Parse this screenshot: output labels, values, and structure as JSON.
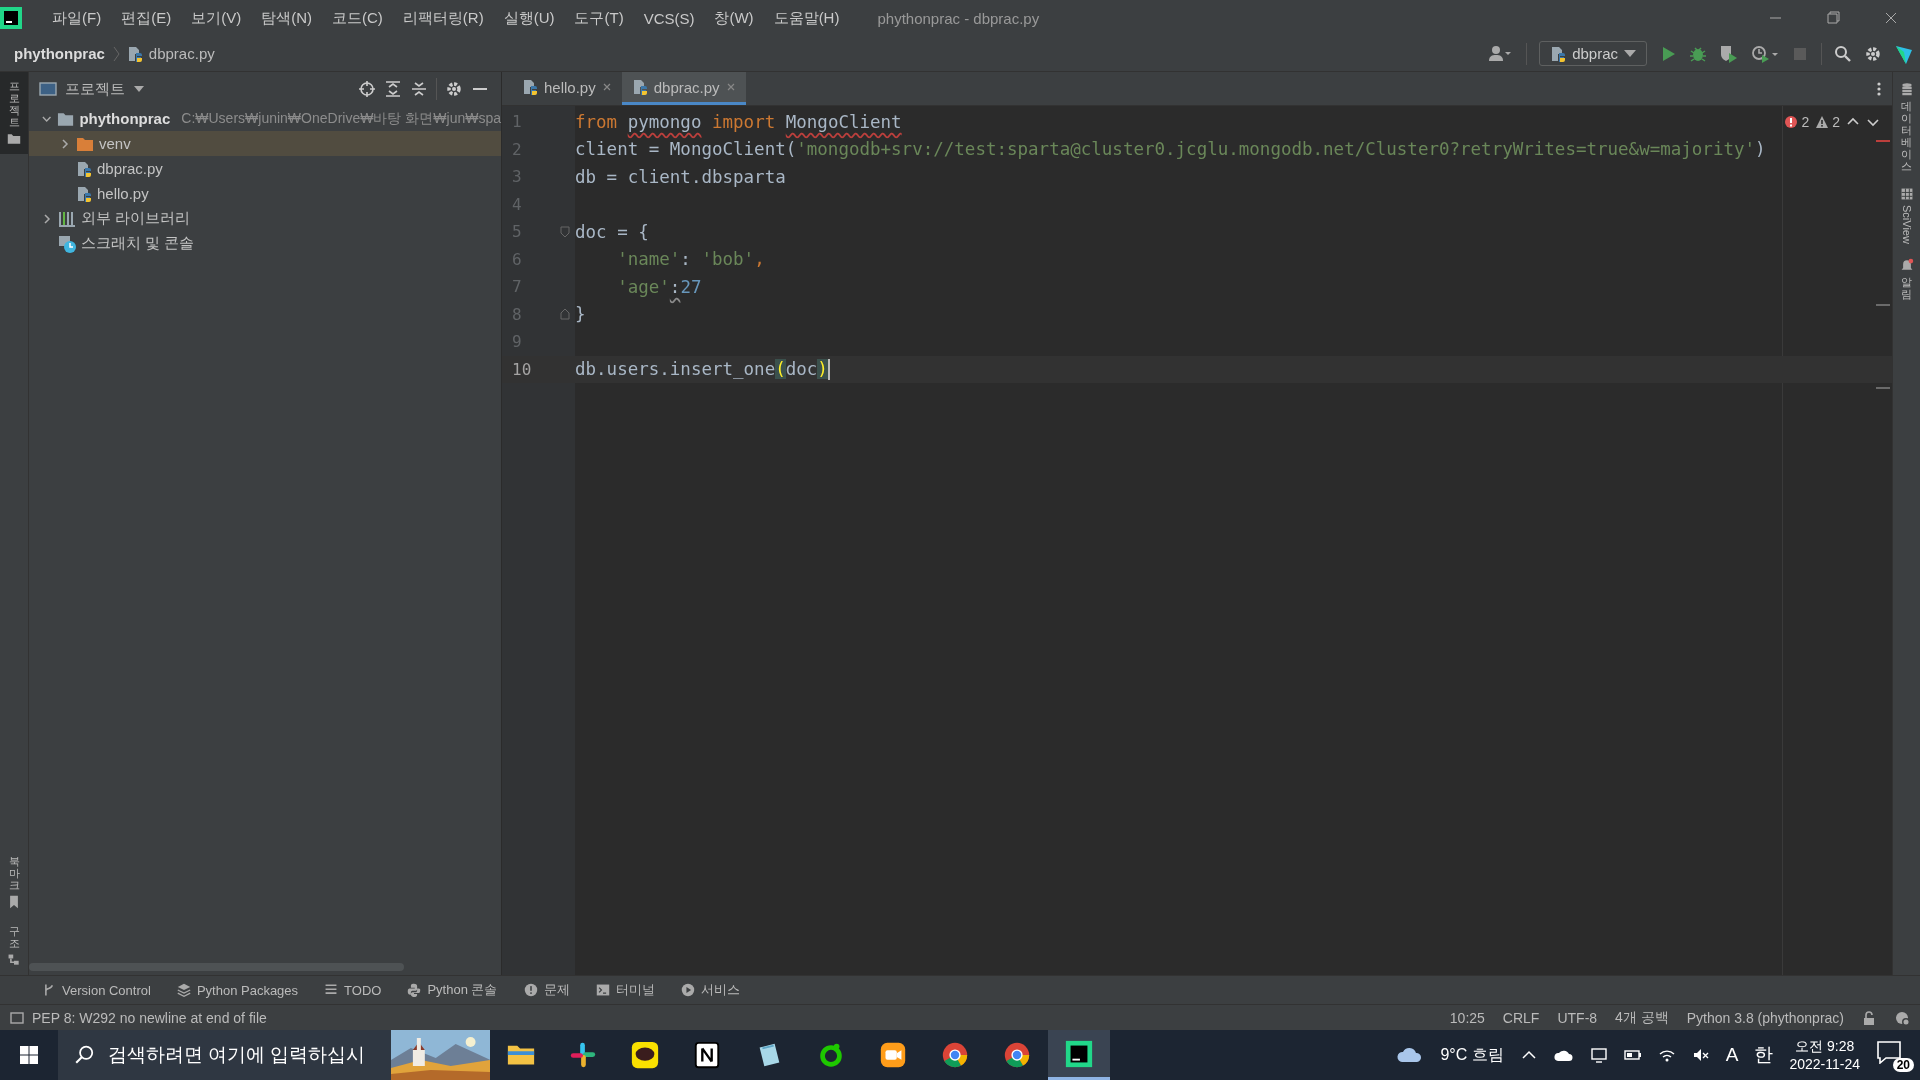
{
  "window": {
    "title": "phythonprac - dbprac.py"
  },
  "menu": [
    "파일(F)",
    "편집(E)",
    "보기(V)",
    "탐색(N)",
    "코드(C)",
    "리팩터링(R)",
    "실행(U)",
    "도구(T)",
    "VCS(S)",
    "창(W)",
    "도움말(H)"
  ],
  "breadcrumbs": [
    "phythonprac",
    "dbprac.py"
  ],
  "run_config": {
    "label": "dbprac"
  },
  "left_strip": [
    {
      "label": "프로젝트",
      "kind": "project",
      "selected": true
    },
    {
      "label": "북마크",
      "kind": "bookmarks",
      "selected": false
    },
    {
      "label": "구조",
      "kind": "structure",
      "selected": false
    }
  ],
  "right_strip": [
    {
      "label": "데이터베이스",
      "kind": "database"
    },
    {
      "label": "SciView",
      "kind": "sciview"
    },
    {
      "label": "알림",
      "kind": "notifications"
    }
  ],
  "project_panel": {
    "title": "프로젝트",
    "tree": [
      {
        "label": "phythonprac",
        "path": "C:₩Users₩junin₩OneDrive₩바탕 화면₩jun₩spa",
        "kind": "folder",
        "expanded": true,
        "selected": false,
        "children": [
          {
            "label": "venv",
            "kind": "venv",
            "expanded": false,
            "selected": true
          },
          {
            "label": "dbprac.py",
            "kind": "python",
            "selected": false
          },
          {
            "label": "hello.py",
            "kind": "python",
            "selected": false
          }
        ]
      },
      {
        "label": "외부 라이브러리",
        "kind": "library",
        "expanded": false,
        "selected": false
      },
      {
        "label": "스크래치 및 콘솔",
        "kind": "scratch",
        "selected": false
      }
    ]
  },
  "tabs": [
    {
      "label": "hello.py",
      "selected": false
    },
    {
      "label": "dbprac.py",
      "selected": true
    }
  ],
  "inspections": {
    "errors": "2",
    "warnings": "2"
  },
  "code": [
    {
      "number": "1",
      "current": false,
      "tokens": [
        {
          "kind": "keyword",
          "text": "from "
        },
        {
          "kind": "flagged",
          "text": "pymongo"
        },
        {
          "kind": "keyword",
          "text": " import "
        },
        {
          "kind": "flagged",
          "text": "MongoClient"
        }
      ]
    },
    {
      "number": "2",
      "current": false,
      "tokens": [
        {
          "kind": "text",
          "text": "client = MongoClient("
        },
        {
          "kind": "string",
          "text": "'mongodb+srv://test:sparta@cluster0.jcglu.mongodb.net/Cluster0?retryWrites=true&w=majority'"
        },
        {
          "kind": "text",
          "text": ")"
        }
      ]
    },
    {
      "number": "3",
      "current": false,
      "tokens": [
        {
          "kind": "text",
          "text": "db = client.dbsparta"
        }
      ]
    },
    {
      "number": "4",
      "current": false
    },
    {
      "number": "5",
      "current": false,
      "kind": "fold-start",
      "tokens": [
        {
          "kind": "text",
          "text": "doc = {"
        }
      ]
    },
    {
      "number": "6",
      "current": false,
      "tokens": [
        {
          "kind": "string",
          "text": "    'name'"
        },
        {
          "kind": "text",
          "text": ": "
        },
        {
          "kind": "string",
          "text": "'bob'"
        },
        {
          "kind": "keyword",
          "text": ","
        }
      ]
    },
    {
      "number": "7",
      "current": false,
      "tokens": [
        {
          "kind": "string",
          "text": "    'age'"
        },
        {
          "kind": "weak",
          "text": ":"
        },
        {
          "kind": "number",
          "text": "27"
        }
      ]
    },
    {
      "number": "8",
      "current": false,
      "kind": "fold-end",
      "tokens": [
        {
          "kind": "text",
          "text": "}"
        }
      ]
    },
    {
      "number": "9",
      "current": false
    },
    {
      "number": "10",
      "current": true,
      "tokens": [
        {
          "kind": "text",
          "text": "db.users.insert_one"
        },
        {
          "kind": "bracket",
          "text": "("
        },
        {
          "kind": "text",
          "text": "doc"
        },
        {
          "kind": "bracket",
          "text": ")"
        }
      ]
    }
  ],
  "bottom_tools": [
    {
      "label": "Version Control",
      "kind": "vcs"
    },
    {
      "label": "Python Packages",
      "kind": "packages"
    },
    {
      "label": "TODO",
      "kind": "todo"
    },
    {
      "label": "Python 콘솔",
      "kind": "console"
    },
    {
      "label": "문제",
      "kind": "problems"
    },
    {
      "label": "터미널",
      "kind": "terminal"
    },
    {
      "label": "서비스",
      "kind": "services"
    }
  ],
  "status_bar": {
    "message": "PEP 8: W292 no newline at end of file",
    "items": [
      "10:25",
      "CRLF",
      "UTF-8",
      "4개 공백",
      "Python 3.8 (phythonprac)"
    ]
  },
  "taskbar": {
    "search": {
      "placeholder": "검색하려면 여기에 입력하십시"
    },
    "apps": [
      {
        "kind": "explorer",
        "selected": false
      },
      {
        "kind": "slack",
        "selected": false
      },
      {
        "kind": "kakaotalk",
        "selected": false
      },
      {
        "kind": "notion",
        "selected": false
      },
      {
        "kind": "notes",
        "selected": false
      },
      {
        "kind": "green-circle",
        "selected": false
      },
      {
        "kind": "orange-app",
        "selected": false
      },
      {
        "kind": "chrome",
        "selected": false
      },
      {
        "kind": "chrome",
        "selected": false
      },
      {
        "kind": "pycharm",
        "selected": true
      }
    ],
    "weather": "9°C 흐림",
    "ime": [
      "A",
      "한"
    ],
    "time": "오전 9:28",
    "date": "2022-11-24",
    "notifications": "20"
  }
}
